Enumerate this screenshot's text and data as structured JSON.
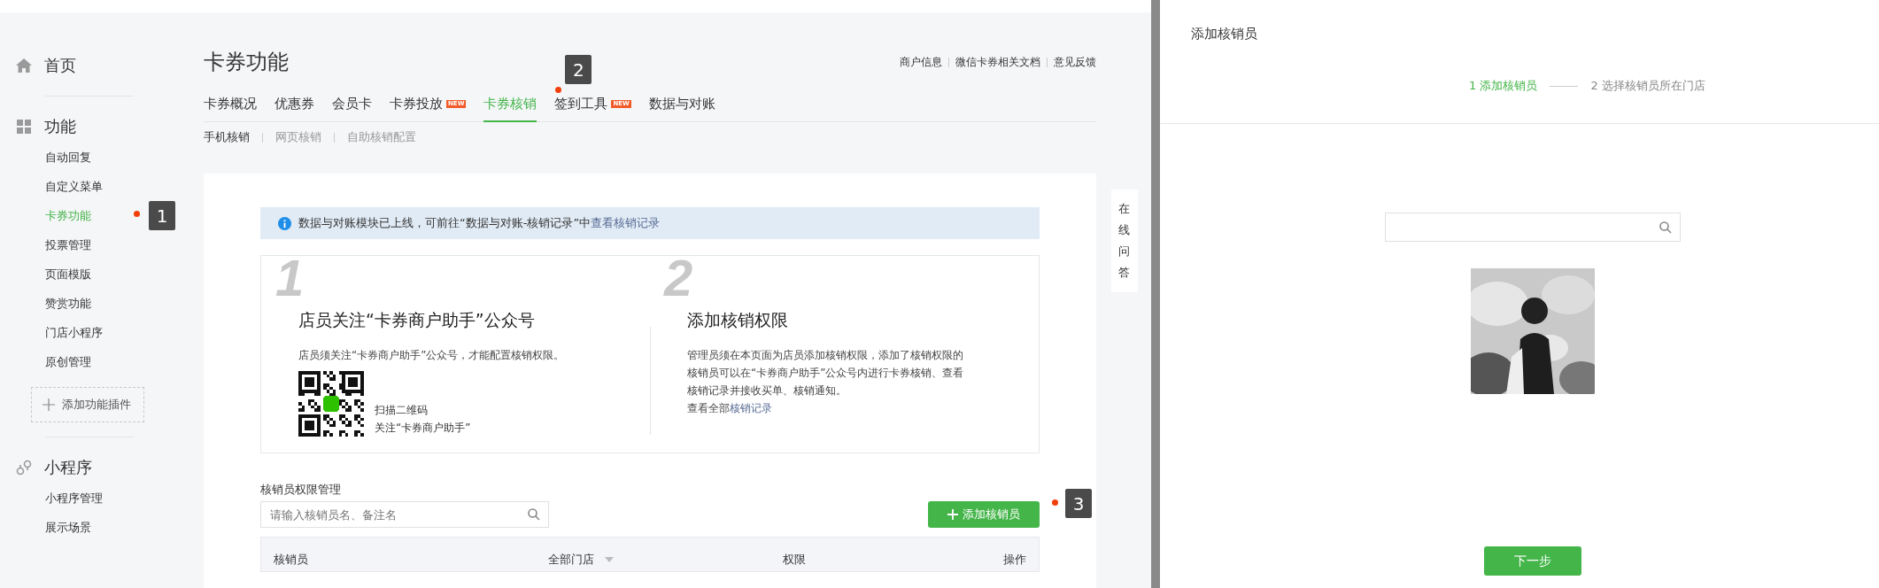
{
  "sidebar": {
    "sections": [
      {
        "title": "首页"
      },
      {
        "title": "功能",
        "items": [
          {
            "label": "自动回复",
            "selected": false
          },
          {
            "label": "自定义菜单",
            "selected": false
          },
          {
            "label": "卡券功能",
            "selected": true,
            "marker": "1"
          },
          {
            "label": "投票管理",
            "selected": false
          },
          {
            "label": "页面模版",
            "selected": false
          },
          {
            "label": "赞赏功能",
            "selected": false
          },
          {
            "label": "门店小程序",
            "selected": false
          },
          {
            "label": "原创管理",
            "selected": false
          }
        ],
        "add_plugin": "添加功能插件"
      },
      {
        "title": "小程序",
        "items": [
          {
            "label": "小程序管理",
            "selected": false
          },
          {
            "label": "展示场景",
            "selected": false
          }
        ]
      }
    ]
  },
  "page": {
    "title": "卡券功能",
    "header_links": [
      "商户信息",
      "微信卡券相关文档",
      "意见反馈"
    ],
    "tabs": [
      {
        "label": "卡券概况",
        "selected": false
      },
      {
        "label": "优惠券",
        "selected": false
      },
      {
        "label": "会员卡",
        "selected": false
      },
      {
        "label": "卡券投放",
        "selected": false,
        "badge": "NEW"
      },
      {
        "label": "卡券核销",
        "selected": true,
        "marker": "2"
      },
      {
        "label": "签到工具",
        "selected": false,
        "badge": "NEW"
      },
      {
        "label": "数据与对账",
        "selected": false
      }
    ],
    "subtabs": [
      {
        "label": "手机核销",
        "selected": true
      },
      {
        "label": "网页核销",
        "selected": false
      },
      {
        "label": "自助核销配置",
        "selected": false
      }
    ],
    "notice": {
      "text": "数据与对账模块已上线，可前往“数据与对账-核销记录”中",
      "link": "查看核销记录"
    },
    "steps": [
      {
        "number": "1",
        "title": "店员关注“卡券商户助手”公众号",
        "text": "店员须关注“卡券商户助手”公众号，才能配置核销权限。",
        "qr_caption": [
          "扫描二维码",
          "关注“卡券商户助手”"
        ]
      },
      {
        "number": "2",
        "title": "添加核销权限",
        "text": "管理员须在本页面为店员添加核销权限，添加了核销权限的核销员可以在“卡券商户助手”公众号内进行卡券核销、查看核销记录并接收买单、核销通知。",
        "link_prefix": "查看全部",
        "link": "核销记录"
      }
    ],
    "manage": {
      "title": "核销员权限管理",
      "search": {
        "placeholder": "请输入核销员名、备注名"
      },
      "add_button": "添加核销员",
      "marker": "3",
      "columns": [
        "核销员",
        "全部门店",
        "权限",
        "操作"
      ]
    },
    "help_tab": "在线问答"
  },
  "dialog": {
    "title": "添加核销员",
    "steps": [
      {
        "label": "1 添加核销员",
        "selected": true
      },
      {
        "label": "2 选择核销员所在门店",
        "selected": false
      }
    ],
    "next_button": "下一步"
  }
}
